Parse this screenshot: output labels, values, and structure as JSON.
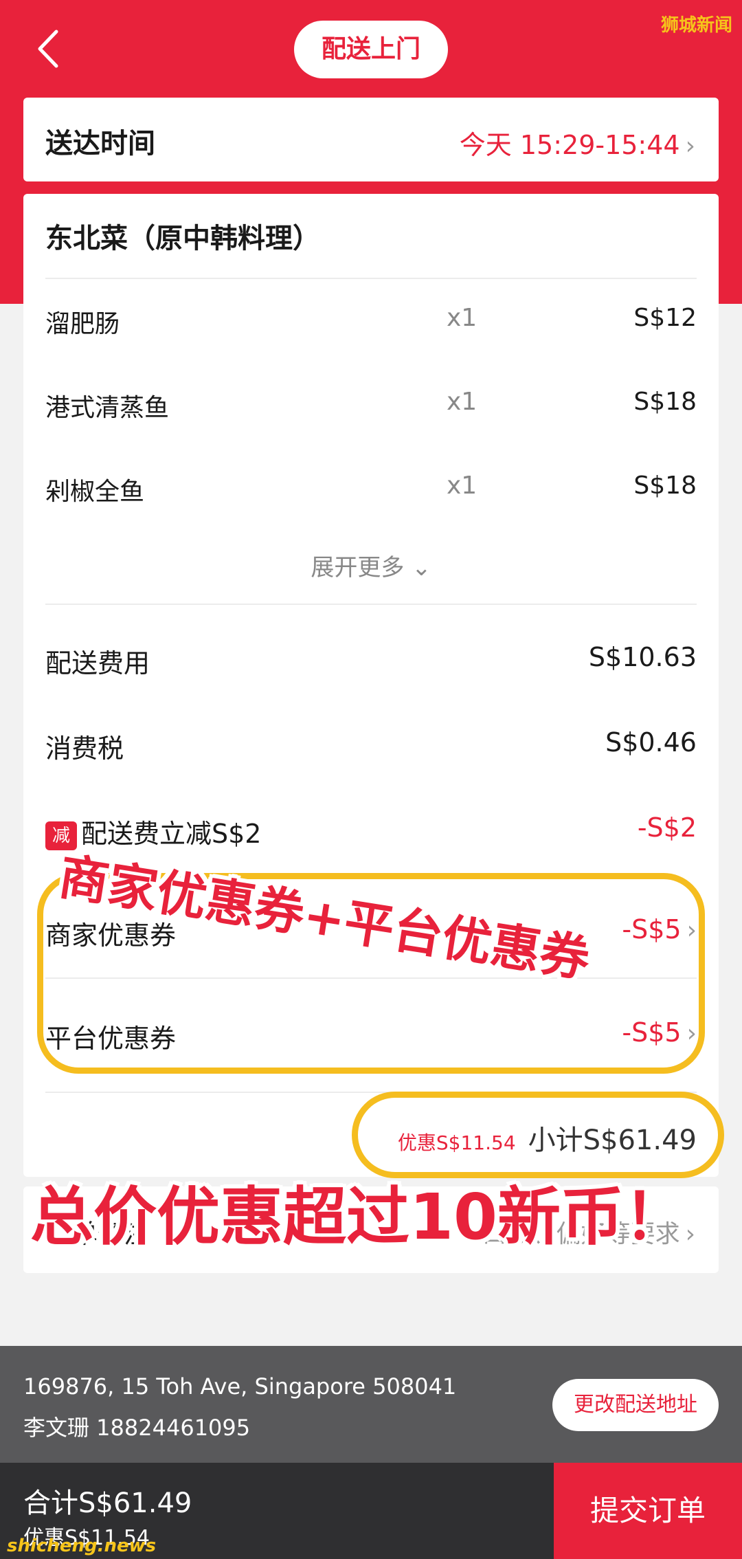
{
  "header": {
    "back_icon": "chevron-left-icon",
    "mode_label": "配送上门",
    "watermark": "狮城新闻"
  },
  "delivery": {
    "label": "送达时间",
    "time": "今天 15:29-15:44"
  },
  "store": {
    "name": "东北菜（原中韩料理）"
  },
  "items": [
    {
      "name": "溜肥肠",
      "qty": "x1",
      "price": "S$12"
    },
    {
      "name": "港式清蒸鱼",
      "qty": "x1",
      "price": "S$18"
    },
    {
      "name": "剁椒全鱼",
      "qty": "x1",
      "price": "S$18"
    }
  ],
  "expand_more": "展开更多",
  "fees": {
    "delivery_fee_label": "配送费用",
    "delivery_fee_value": "S$10.63",
    "tax_label": "消费税",
    "tax_value": "S$0.46",
    "discount_tag": "减",
    "delivery_discount_label": "配送费立减S$2",
    "delivery_discount_value": "-S$2",
    "merchant_coupon_label": "商家优惠券",
    "merchant_coupon_value": "-S$5",
    "platform_coupon_label": "平台优惠券",
    "platform_coupon_value": "-S$5"
  },
  "subtotal": {
    "saving": "优惠S$11.54",
    "total": "小计S$61.49"
  },
  "remark": {
    "label": "订单备注",
    "placeholder": "口味、偏好等要求"
  },
  "address": {
    "line1": "169876, 15 Toh Ave, Singapore 508041",
    "line2": "李文珊 18824461095",
    "change_button": "更改配送地址"
  },
  "footer": {
    "total": "合计S$61.49",
    "saving": "优惠S$11.54",
    "submit": "提交订单",
    "watermark": "shicheng.news"
  },
  "overlay": {
    "caption_1": "商家优惠券+平台优惠券",
    "caption_2": "总价优惠超过10新币！"
  },
  "colors": {
    "brand_red": "#e8223b",
    "highlight_yellow": "#f5bd1f"
  }
}
